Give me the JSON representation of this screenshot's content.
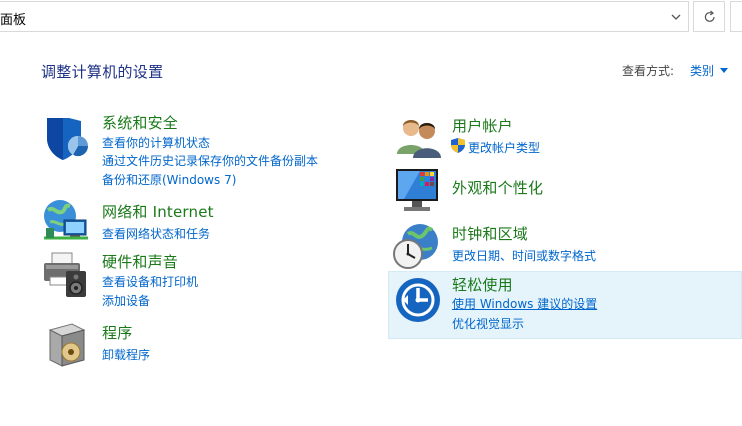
{
  "address": {
    "text": "面板"
  },
  "page_title": "调整计算机的设置",
  "view_by": {
    "label": "查看方式:",
    "value": "类别"
  },
  "categories": {
    "system_security": {
      "title": "系统和安全",
      "links": [
        "查看你的计算机状态",
        "通过文件历史记录保存你的文件备份副本",
        "备份和还原(Windows 7)"
      ]
    },
    "network": {
      "title": "网络和 Internet",
      "links": [
        "查看网络状态和任务"
      ]
    },
    "hardware": {
      "title": "硬件和声音",
      "links": [
        "查看设备和打印机",
        "添加设备"
      ]
    },
    "programs": {
      "title": "程序",
      "links": [
        "卸载程序"
      ]
    },
    "user_accounts": {
      "title": "用户帐户",
      "links": [
        "更改帐户类型"
      ]
    },
    "appearance": {
      "title": "外观和个性化",
      "links": []
    },
    "clock_region": {
      "title": "时钟和区域",
      "links": [
        "更改日期、时间或数字格式"
      ]
    },
    "ease_access": {
      "title": "轻松使用",
      "links": [
        "使用 Windows 建议的设置",
        "优化视觉显示"
      ]
    }
  },
  "colors": {
    "title_green": "#1a7a1a",
    "link_blue": "#0066cc",
    "heading_blue": "#1e3287",
    "highlight": "#e5f3fb"
  },
  "icons": [
    "shield-icon",
    "network-globe-icon",
    "printer-speaker-icon",
    "programs-box-icon",
    "users-icon",
    "monitor-color-icon",
    "clock-globe-icon",
    "ease-of-access-icon",
    "uac-shield-icon",
    "chevron-down-icon",
    "refresh-icon"
  ]
}
